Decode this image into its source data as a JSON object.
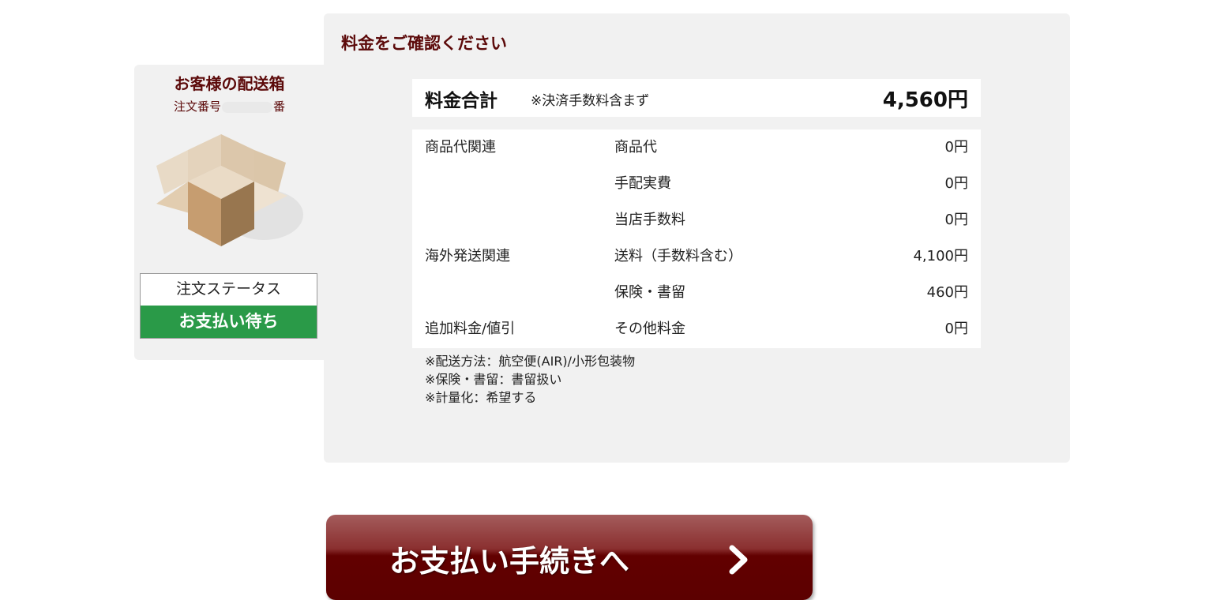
{
  "left_panel": {
    "title": "お客様の配送箱",
    "order_prefix": "注文番号",
    "order_suffix": "番",
    "status_label": "注文ステータス",
    "status_value": "お支払い待ち",
    "status_color": "#2a9a48"
  },
  "main": {
    "title": "料金をご確認ください",
    "total": {
      "label": "料金合計",
      "note": "※決済手数料含まず",
      "amount": "4,560円"
    },
    "fees": [
      {
        "category": "商品代関連",
        "item": "商品代",
        "amount": "0円"
      },
      {
        "category": "",
        "item": "手配実費",
        "amount": "0円"
      },
      {
        "category": "",
        "item": "当店手数料",
        "amount": "0円"
      },
      {
        "category": "海外発送関連",
        "item": "送料（手数料含む）",
        "amount": "4,100円"
      },
      {
        "category": "",
        "item": "保険・書留",
        "amount": "460円"
      },
      {
        "category": "追加料金/値引",
        "item": "その他料金",
        "amount": "0円"
      }
    ],
    "notes": [
      "※配送方法：航空便(AIR)/小形包装物",
      "※保険・書留：書留扱い",
      "※計量化：希望する"
    ]
  },
  "pay_button": {
    "label": "お支払い手続きへ",
    "icon": "chevron-right-icon",
    "color": "#5c0000"
  },
  "box_icon": "open-box-icon",
  "accent_color": "#5c0a0a"
}
